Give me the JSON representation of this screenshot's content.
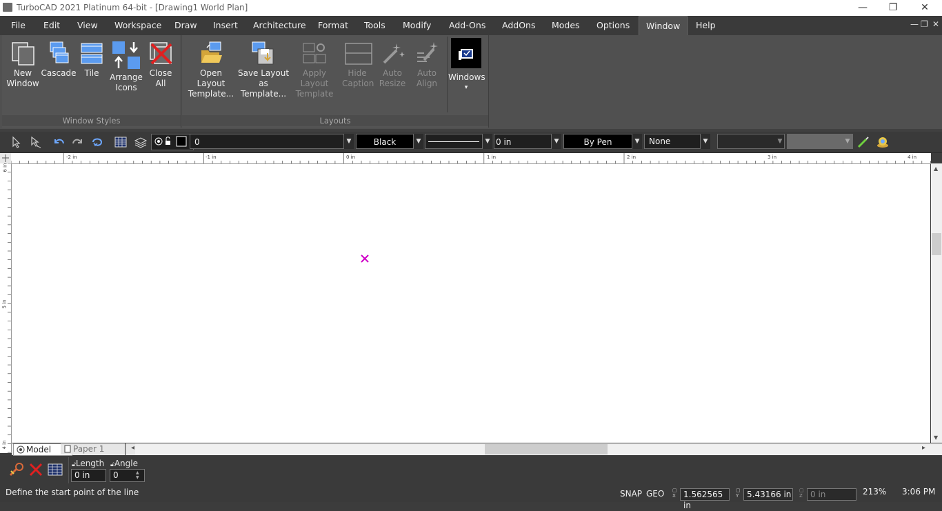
{
  "window": {
    "title": "TurboCAD 2021 Platinum 64-bit - [Drawing1 World Plan]",
    "minimize": "—",
    "restore": "❐",
    "close": "✕"
  },
  "menu": {
    "items": [
      "File",
      "Edit",
      "View",
      "Workspace",
      "Draw",
      "Insert",
      "Architecture",
      "Format",
      "Tools",
      "Modify",
      "Add-Ons",
      "AddOns",
      "Modes",
      "Options",
      "Window",
      "Help"
    ],
    "active": "Window",
    "mdi_minimize": "—",
    "mdi_restore": "❐",
    "mdi_close": "✕"
  },
  "ribbon": {
    "window_styles": {
      "label": "Window Styles",
      "buttons": [
        {
          "line1": "New",
          "line2": "Window",
          "icon": "new-window-icon"
        },
        {
          "line1": "Cascade",
          "line2": "",
          "icon": "cascade-icon"
        },
        {
          "line1": "Tile",
          "line2": "",
          "icon": "tile-icon"
        },
        {
          "line1": "Arrange",
          "line2": "Icons",
          "icon": "arrange-icons-icon"
        },
        {
          "line1": "Close",
          "line2": "All",
          "icon": "close-all-icon"
        }
      ]
    },
    "layouts": {
      "label": "Layouts",
      "buttons": [
        {
          "line1": "Open Layout",
          "line2": "Template...",
          "icon": "open-layout-icon",
          "enabled": true
        },
        {
          "line1": "Save Layout",
          "line2": "as Template...",
          "icon": "save-layout-icon",
          "enabled": true
        },
        {
          "line1": "Apply Layout",
          "line2": "Template",
          "icon": "apply-layout-icon",
          "enabled": false
        },
        {
          "line1": "Hide",
          "line2": "Caption",
          "icon": "hide-caption-icon",
          "enabled": false
        },
        {
          "line1": "Auto",
          "line2": "Resize",
          "icon": "auto-resize-icon",
          "enabled": false
        },
        {
          "line1": "Auto",
          "line2": "Align",
          "icon": "auto-align-icon",
          "enabled": false
        }
      ]
    },
    "windows": {
      "label": "Windows",
      "arrow": "▾",
      "icon": "windows-icon"
    }
  },
  "toolbar": {
    "layer_value": "0",
    "color_value": "Black",
    "linewidth_value": "0 in",
    "pen_value": "By Pen",
    "pattern_value": "None",
    "dropdown_arrow": "▼"
  },
  "ruler": {
    "h_labels": [
      "-2 in",
      "-1 in",
      "0 in",
      "1 in",
      "2 in",
      "3 in",
      "4 in"
    ],
    "v_labels": [
      "6 in",
      "5 in",
      "4 in"
    ]
  },
  "sheets": {
    "tabs": [
      "Model",
      "Paper 1"
    ],
    "active": "Model",
    "left_arrow": "◂",
    "right_arrow": "▸"
  },
  "inspector": {
    "length_label": "Length",
    "length_value": "0 in",
    "angle_label": "Angle",
    "angle_value": "0"
  },
  "status": {
    "prompt": "Define the start point of the line",
    "snap": "SNAP",
    "geo": "GEO",
    "x_label": "X",
    "x_value": "1.562565 in",
    "y_label": "Y",
    "y_value": "5.43166 in",
    "z_label": "Z",
    "z_value": "0 in",
    "zoom": "213%",
    "time": "3:06 PM"
  },
  "colors": {
    "accent_magenta": "#d000c8",
    "ribbon_blue": "#5b9bef",
    "close_red": "#e02020"
  }
}
